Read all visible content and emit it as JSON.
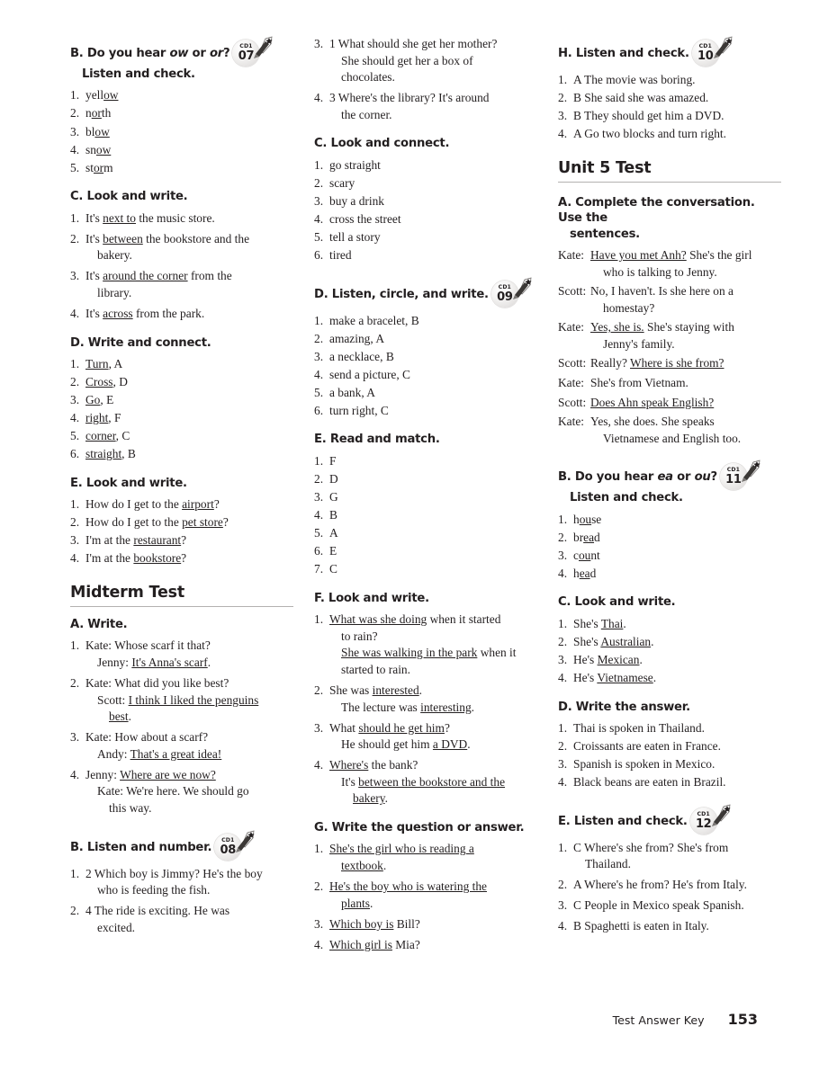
{
  "footer": {
    "label": "Test Answer Key",
    "page": "153"
  },
  "icons": {
    "cd_label": "CD1"
  },
  "columns": [
    {
      "blocks": [
        {
          "type": "section",
          "heading_pre": "B. Do you hear ",
          "heading_em1": "ow",
          "heading_mid": " or ",
          "heading_em2": "or",
          "heading_post": "?",
          "heading_line2": "Listen and check.",
          "cd": "07",
          "items": [
            {
              "n": "1.",
              "text": "yell<u>ow</u>"
            },
            {
              "n": "2.",
              "text": "n<u>or</u>th"
            },
            {
              "n": "3.",
              "text": "bl<u>ow</u>"
            },
            {
              "n": "4.",
              "text": "sn<u>ow</u>"
            },
            {
              "n": "5.",
              "text": "st<u>or</u>m"
            }
          ]
        },
        {
          "type": "section",
          "heading": "C. Look and write.",
          "items": [
            {
              "n": "1.",
              "text": "It's <u>next to</u> the music store."
            },
            {
              "n": "2.",
              "text": "It's <u>between</u> the bookstore and the",
              "sub": "bakery."
            },
            {
              "n": "3.",
              "text": "It's <u>around the corner</u> from the",
              "sub": "library."
            },
            {
              "n": "4.",
              "text": "It's <u>across</u> from the park."
            }
          ]
        },
        {
          "type": "section",
          "heading": "D. Write and connect.",
          "items": [
            {
              "n": "1.",
              "text": "<u>Turn</u>, A"
            },
            {
              "n": "2.",
              "text": "<u>Cross</u>, D"
            },
            {
              "n": "3.",
              "text": "<u>Go</u>, E"
            },
            {
              "n": "4.",
              "text": "<u>right</u>, F"
            },
            {
              "n": "5.",
              "text": "<u>corner</u>, C"
            },
            {
              "n": "6.",
              "text": "<u>straight</u>, B"
            }
          ]
        },
        {
          "type": "section",
          "heading": "E. Look and write.",
          "items": [
            {
              "n": "1.",
              "text": "How do I get to the <u>airport</u>?"
            },
            {
              "n": "2.",
              "text": "How do I get to the <u>pet store</u>?"
            },
            {
              "n": "3.",
              "text": "I'm at the <u>restaurant</u>?"
            },
            {
              "n": "4.",
              "text": "I'm at the <u>bookstore</u>?"
            }
          ]
        },
        {
          "type": "unit",
          "title": "Midterm Test"
        },
        {
          "type": "section",
          "heading": "A. Write.",
          "items": [
            {
              "n": "1.",
              "text": "Kate: Whose scarf it that?",
              "sub": "Jenny: <u>It's Anna's scarf</u>."
            },
            {
              "n": "2.",
              "text": "Kate: What did you like best?",
              "sub": "Scott: <u>I think I liked the penguins </u>",
              "sub2": "<u>best</u>."
            },
            {
              "n": "3.",
              "text": "Kate: How about a scarf?",
              "sub": "Andy: <u>That's a great idea!</u>"
            },
            {
              "n": "4.",
              "text": "Jenny: <u>Where are we now?</u>",
              "sub": "Kate: We're here. We should go",
              "sub2": "this way."
            }
          ]
        },
        {
          "type": "section",
          "heading": "B. Listen and number.",
          "cd": "08",
          "items": [
            {
              "n": "1.",
              "text": "2 Which boy is Jimmy? He's the boy",
              "sub": "who is feeding the fish."
            },
            {
              "n": "2.",
              "text": "4 The ride is exciting. He was",
              "sub": "excited."
            }
          ]
        }
      ]
    },
    {
      "blocks": [
        {
          "type": "list-only",
          "items": [
            {
              "n": "3.",
              "text": "1 What should she get her mother?",
              "sub": "She should get her a box of",
              "sub2_flat": "chocolates."
            },
            {
              "n": "4.",
              "text": "3 Where's the library? It's around",
              "sub": "the corner."
            }
          ]
        },
        {
          "type": "section",
          "heading": "C. Look and connect.",
          "items": [
            {
              "n": "1.",
              "text": "go straight"
            },
            {
              "n": "2.",
              "text": "scary"
            },
            {
              "n": "3.",
              "text": "buy a drink"
            },
            {
              "n": "4.",
              "text": "cross the street"
            },
            {
              "n": "5.",
              "text": "tell a story"
            },
            {
              "n": "6.",
              "text": "tired"
            }
          ]
        },
        {
          "type": "section",
          "heading": "D. Listen, circle, and write.",
          "cd": "09",
          "items": [
            {
              "n": "1.",
              "text": "make a bracelet, B"
            },
            {
              "n": "2.",
              "text": "amazing, A"
            },
            {
              "n": "3.",
              "text": "a necklace, B"
            },
            {
              "n": "4.",
              "text": "send a picture, C"
            },
            {
              "n": "5.",
              "text": "a bank, A"
            },
            {
              "n": "6.",
              "text": "turn right, C"
            }
          ]
        },
        {
          "type": "section",
          "heading": "E. Read and match.",
          "items": [
            {
              "n": "1.",
              "text": "F"
            },
            {
              "n": "2.",
              "text": "D"
            },
            {
              "n": "3.",
              "text": "G"
            },
            {
              "n": "4.",
              "text": "B"
            },
            {
              "n": "5.",
              "text": "A"
            },
            {
              "n": "6.",
              "text": "E"
            },
            {
              "n": "7.",
              "text": "C"
            }
          ]
        },
        {
          "type": "section",
          "heading": "F. Look and write.",
          "items": [
            {
              "n": "1.",
              "text": "<u>What was she doing</u> when it started",
              "sub": "to rain?",
              "sub_b": "<u>She was walking in the park</u> when it",
              "sub_c": "started to rain."
            },
            {
              "n": "2.",
              "text": "She was <u>interested</u>.",
              "sub": "The lecture was <u>interesting</u>."
            },
            {
              "n": "3.",
              "text": "What <u>should he get him</u>?",
              "sub": "He should get him <u>a DVD</u>."
            },
            {
              "n": "4.",
              "text": "<u>Where's</u> the bank?",
              "sub": "It's <u>between the bookstore and the </u>",
              "sub2": "<u>bakery</u>."
            }
          ]
        },
        {
          "type": "section",
          "heading": "G. Write the question or answer.",
          "items": [
            {
              "n": "1.",
              "text": "<u>She's the girl who is reading a </u>",
              "sub": "<u>textbook</u>."
            },
            {
              "n": "2.",
              "text": "<u>He's the boy who is watering the </u>",
              "sub": "<u>plants</u>."
            },
            {
              "n": "3.",
              "text": "<u>Which boy is</u> Bill?"
            },
            {
              "n": "4.",
              "text": "<u>Which girl is</u> Mia?"
            }
          ]
        }
      ]
    },
    {
      "blocks": [
        {
          "type": "section",
          "heading": "H. Listen and check.",
          "cd": "10",
          "items": [
            {
              "n": "1.",
              "text": "A The movie was boring."
            },
            {
              "n": "2.",
              "text": "B She said she was amazed."
            },
            {
              "n": "3.",
              "text": "B They should get him a DVD."
            },
            {
              "n": "4.",
              "text": "A Go two blocks and turn right."
            }
          ]
        },
        {
          "type": "unit",
          "title": "Unit 5 Test"
        },
        {
          "type": "dialogue",
          "heading": "A. Complete the conversation. Use the",
          "heading_line2": "sentences.",
          "lines": [
            {
              "spk": "Kate:",
              "text": "<u>Have you met Anh?</u> She's the girl",
              "cont": "who is talking to Jenny."
            },
            {
              "spk": "Scott:",
              "text": "No, I haven't. Is she here on a",
              "cont": "homestay?"
            },
            {
              "spk": "Kate:",
              "text": "<u>Yes, she is.</u> She's staying with",
              "cont": "Jenny's family."
            },
            {
              "spk": "Scott:",
              "text": "Really? <u>Where is she from?</u>"
            },
            {
              "spk": "Kate:",
              "text": "She's from Vietnam."
            },
            {
              "spk": "Scott:",
              "text": "<u>Does Ahn speak English?</u>"
            },
            {
              "spk": "Kate:",
              "text": "Yes, she does. She speaks",
              "cont": "Vietnamese and English too."
            }
          ]
        },
        {
          "type": "section",
          "heading_pre": "B. Do you hear ",
          "heading_em1": "ea",
          "heading_mid": " or ",
          "heading_em2": "ou",
          "heading_post": "?",
          "heading_line2": "Listen and check.",
          "cd": "11",
          "items": [
            {
              "n": "1.",
              "text": "h<u>ou</u>se"
            },
            {
              "n": "2.",
              "text": "br<u>ea</u>d"
            },
            {
              "n": "3.",
              "text": "c<u>ou</u>nt"
            },
            {
              "n": "4.",
              "text": "h<u>ea</u>d"
            }
          ]
        },
        {
          "type": "section",
          "heading": "C. Look and write.",
          "items": [
            {
              "n": "1.",
              "text": "She's <u>Thai</u>."
            },
            {
              "n": "2.",
              "text": "She's <u>Australian</u>."
            },
            {
              "n": "3.",
              "text": "He's <u>Mexican</u>."
            },
            {
              "n": "4.",
              "text": "He's <u>Vietnamese</u>."
            }
          ]
        },
        {
          "type": "section",
          "heading": "D. Write the answer.",
          "items": [
            {
              "n": "1.",
              "text": "Thai is spoken in Thailand."
            },
            {
              "n": "2.",
              "text": "Croissants are eaten in France."
            },
            {
              "n": "3.",
              "text": "Spanish is spoken in Mexico."
            },
            {
              "n": "4.",
              "text": "Black beans are eaten in Brazil."
            }
          ]
        },
        {
          "type": "section",
          "heading": "E. Listen and check.",
          "cd": "12",
          "items": [
            {
              "n": "1.",
              "text": "C Where's she from? She's from",
              "sub": "Thailand."
            },
            {
              "n": "2.",
              "text": "A Where's he from? He's from Italy."
            },
            {
              "n": "3.",
              "text": "C People in Mexico speak Spanish."
            },
            {
              "n": "4.",
              "text": "B Spaghetti is eaten in Italy."
            }
          ]
        }
      ]
    }
  ]
}
